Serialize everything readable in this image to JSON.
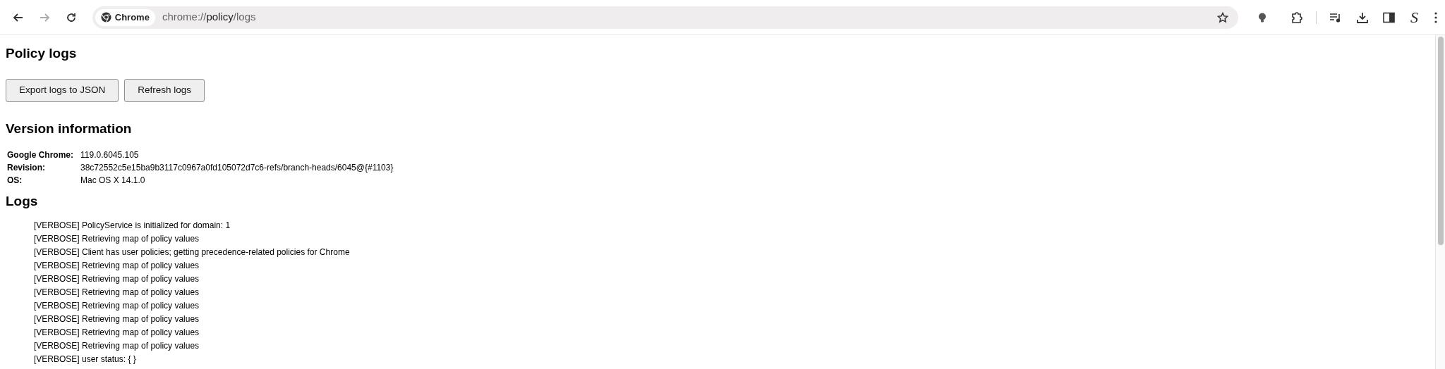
{
  "toolbar": {
    "back_enabled": true,
    "forward_enabled": false,
    "chip_label": "Chrome",
    "url": {
      "scheme": "chrome://",
      "host": "policy",
      "path": "/logs"
    },
    "extension_glyph": "S"
  },
  "page": {
    "title": "Policy logs",
    "buttons": [
      "Export logs to JSON",
      "Refresh logs"
    ],
    "version_heading": "Version information",
    "version_rows": [
      {
        "label": "Google Chrome:",
        "value": "119.0.6045.105"
      },
      {
        "label": "Revision:",
        "value": "38c72552c5e15ba9b3117c0967a0fd105072d7c6-refs/branch-heads/6045@{#1103}"
      },
      {
        "label": "OS:",
        "value": "Mac OS X 14.1.0"
      }
    ],
    "logs_heading": "Logs",
    "logs": [
      "[VERBOSE] PolicyService is initialized for domain: 1",
      "[VERBOSE] Retrieving map of policy values",
      "[VERBOSE] Client has user policies; getting precedence-related policies for Chrome",
      "[VERBOSE] Retrieving map of policy values",
      "[VERBOSE] Retrieving map of policy values",
      "[VERBOSE] Retrieving map of policy values",
      "[VERBOSE] Retrieving map of policy values",
      "[VERBOSE] Retrieving map of policy values",
      "[VERBOSE] Retrieving map of policy values",
      "[VERBOSE] Retrieving map of policy values",
      "[VERBOSE] user status: { }"
    ]
  }
}
